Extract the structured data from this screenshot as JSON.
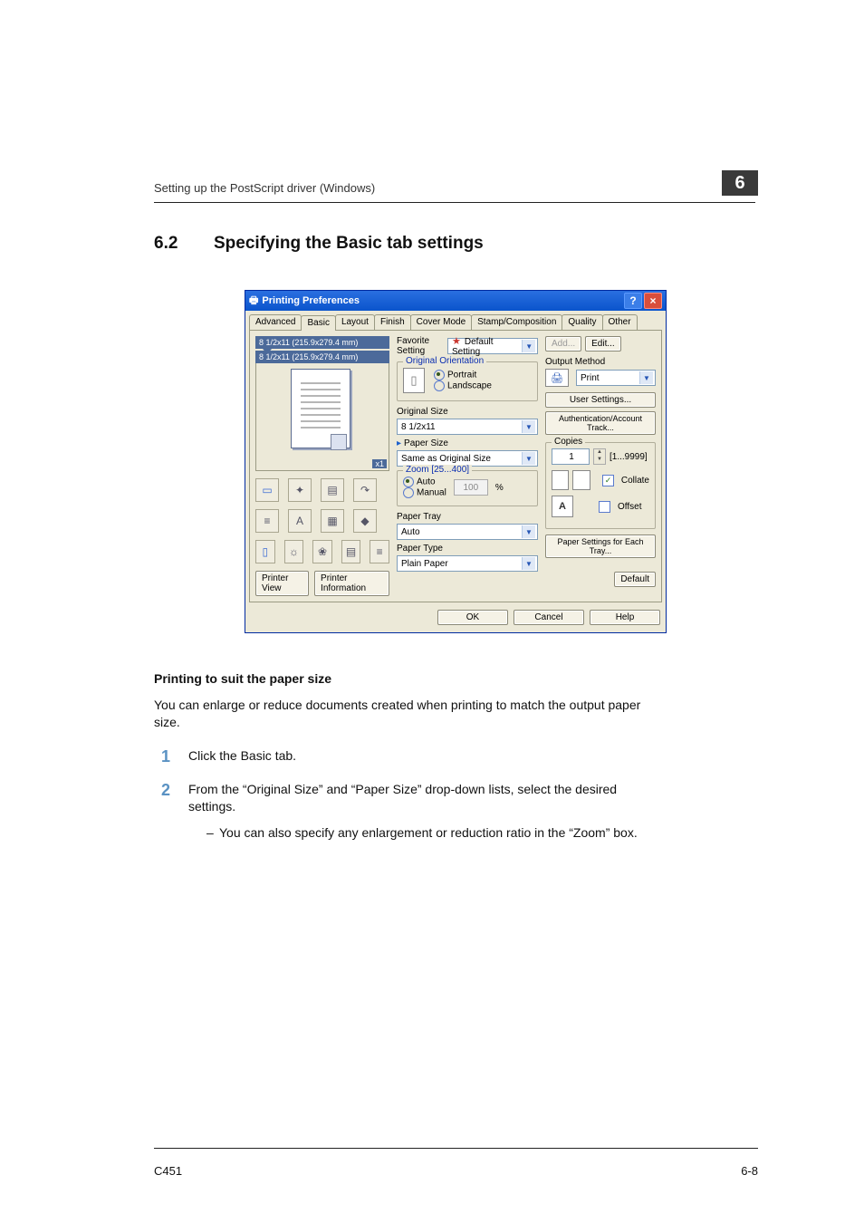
{
  "header": {
    "running_head": "Setting up the PostScript driver (Windows)",
    "chapter": "6"
  },
  "section": {
    "number": "6.2",
    "title": "Specifying the Basic tab settings"
  },
  "dialog": {
    "title": "Printing Preferences",
    "tabs": [
      "Advanced",
      "Basic",
      "Layout",
      "Finish",
      "Cover Mode",
      "Stamp/Composition",
      "Quality",
      "Other"
    ],
    "active_tab": "Basic",
    "favorite_label": "Favorite Setting",
    "favorite_value": "Default Setting",
    "add_btn": "Add...",
    "edit_btn": "Edit...",
    "preview_top": "8 1/2x11 (215.9x279.4 mm)",
    "preview_bot": "8 1/2x11 (215.9x279.4 mm)",
    "x1": "x1",
    "printer_view_btn": "Printer View",
    "printer_info_btn": "Printer Information",
    "orientation": {
      "title": "Original Orientation",
      "portrait": "Portrait",
      "landscape": "Landscape"
    },
    "original_size_label": "Original Size",
    "original_size_value": "8 1/2x11",
    "paper_size_label": "Paper Size",
    "paper_size_value": "Same as Original Size",
    "zoom": {
      "title": "Zoom [25...400]",
      "auto": "Auto",
      "manual": "Manual",
      "value": "100",
      "pct": "%"
    },
    "paper_tray_label": "Paper Tray",
    "paper_tray_value": "Auto",
    "paper_type_label": "Paper Type",
    "paper_type_value": "Plain Paper",
    "output_method_label": "Output Method",
    "output_method_value": "Print",
    "user_settings_btn": "User Settings...",
    "auth_btn": "Authentication/Account Track...",
    "copies_label": "Copies",
    "copies_value": "1",
    "copies_range": "[1...9999]",
    "collate_label": "Collate",
    "offset_label": "Offset",
    "paper_settings_btn": "Paper Settings for Each Tray...",
    "default_btn": "Default",
    "ok": "OK",
    "cancel": "Cancel",
    "help": "Help"
  },
  "body": {
    "subhead": "Printing to suit the paper size",
    "intro": "You can enlarge or reduce documents created when printing to match the output paper size.",
    "step1": "Click the Basic tab.",
    "step2_a": "From the “Original Size” and “Paper Size” drop-down lists, select the desired settings.",
    "step2_b": "You can also specify any enlargement or reduction ratio in the “Zoom” box."
  },
  "footer": {
    "left": "C451",
    "right": "6-8"
  }
}
